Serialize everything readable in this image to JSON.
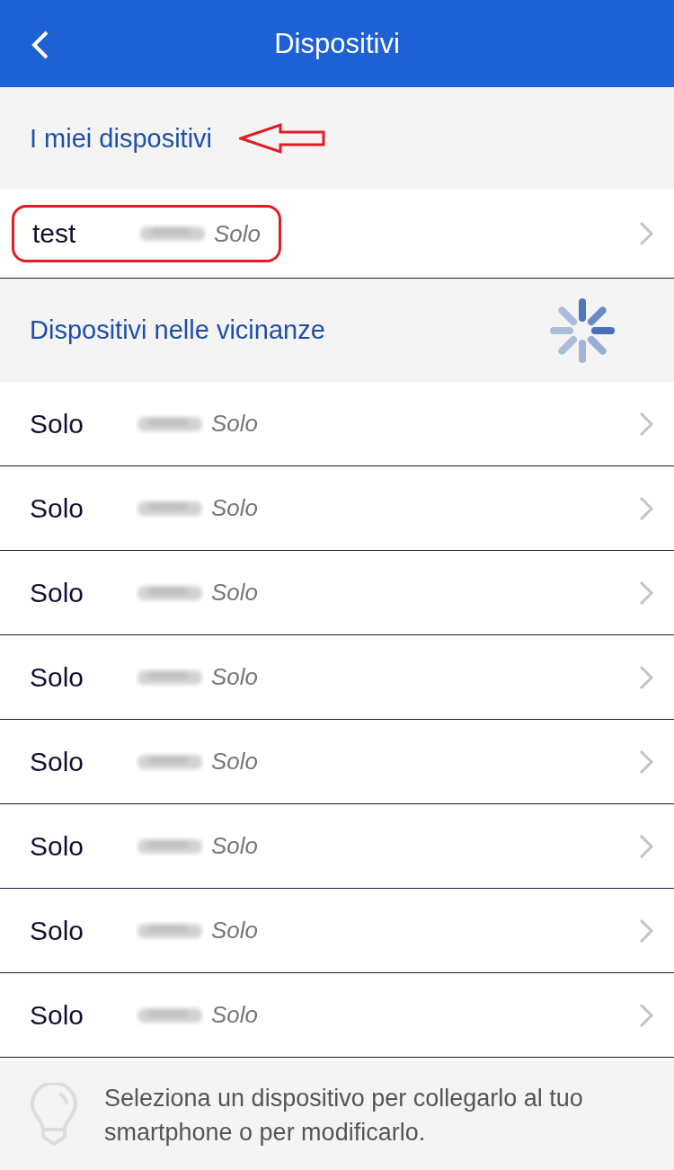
{
  "header": {
    "title": "Dispositivi"
  },
  "my_devices": {
    "title": "I miei dispositivi",
    "highlighted": true,
    "items": [
      {
        "name": "test",
        "type": "Solo"
      }
    ]
  },
  "nearby_devices": {
    "title": "Dispositivi nelle vicinanze",
    "loading": true,
    "items": [
      {
        "name": "Solo",
        "type": "Solo"
      },
      {
        "name": "Solo",
        "type": "Solo"
      },
      {
        "name": "Solo",
        "type": "Solo"
      },
      {
        "name": "Solo",
        "type": "Solo"
      },
      {
        "name": "Solo",
        "type": "Solo"
      },
      {
        "name": "Solo",
        "type": "Solo"
      },
      {
        "name": "Solo",
        "type": "Solo"
      },
      {
        "name": "Solo",
        "type": "Solo"
      }
    ]
  },
  "tip": {
    "text": "Seleziona un dispositivo per collegarlo al tuo smartphone o per modificarlo."
  }
}
